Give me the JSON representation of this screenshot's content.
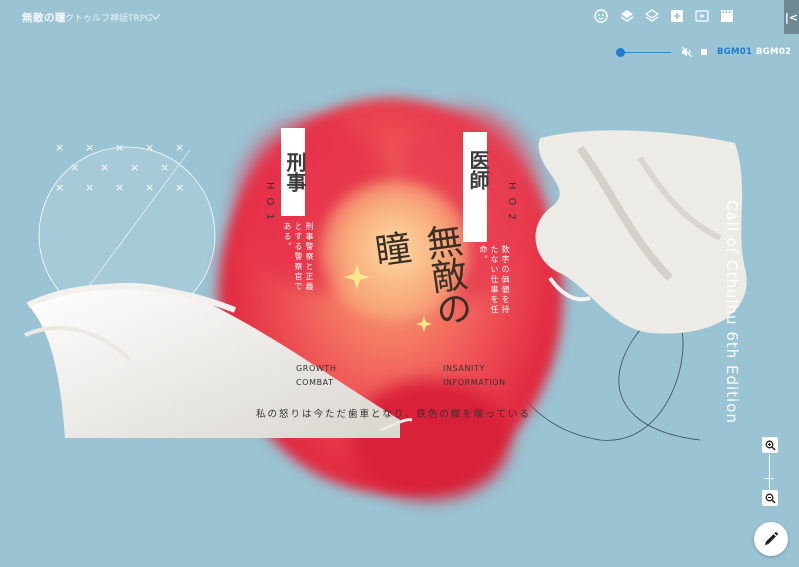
{
  "header": {
    "title": "無敵の瞳",
    "subtitle": "クトゥルフ神話TRPG"
  },
  "toolbar": {
    "icons": [
      "face-icon",
      "layers-icon",
      "layers-outline-icon",
      "add-image-icon",
      "video-icon",
      "clapperboard-icon"
    ],
    "collapse_label": "|<"
  },
  "bgm": {
    "volume": 0.0,
    "muted": true,
    "tracks": [
      "BGM01",
      "BGM02"
    ],
    "active_track": "BGM01",
    "accent_color": "#2f87d6"
  },
  "artwork": {
    "handout1": {
      "role": "刑事",
      "code": "HO1",
      "desc": "刑事警察と正義とする警察官である。"
    },
    "handout2": {
      "role": "医師",
      "code": "HO2",
      "desc": "数字の価値を持たない仕事を任命。"
    },
    "logo": "無敵の瞳",
    "stats_left": [
      "GROWTH",
      "COMBAT"
    ],
    "stats_right": [
      "INSANITY",
      "INFORMATION"
    ],
    "tagline": "私の怒りは今ただ歯車となり、鉄色の轍を喫っている",
    "edition": "Call of Cthulhu 6th Edition"
  },
  "zoom": {
    "in": "zoom-in",
    "out": "zoom-out"
  }
}
